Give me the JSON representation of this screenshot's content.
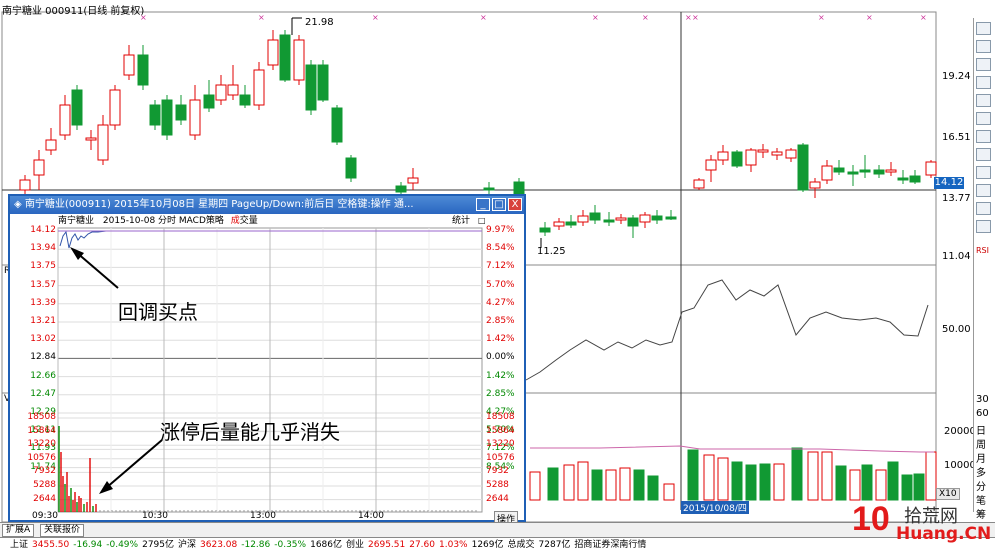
{
  "window": {
    "title": "南宁糖业 000911(日线 前复权)"
  },
  "main_chart": {
    "peak_label": "21.98",
    "trough_label": "11.25",
    "price_ticks": [
      "19.24",
      "16.51",
      "13.77",
      "11.04"
    ],
    "current_price": "14.12",
    "indicator_tick": "50.00",
    "volume_ticks": [
      "20000",
      "10000"
    ],
    "volume_unit": "X10",
    "date_label": "2015/10/08/四",
    "side_letter_r": "R",
    "side_letter_v": "V"
  },
  "popup": {
    "title": "南宁糖业(000911) 2015年10月08日 星期四 PageUp/Down:前后日 空格键:操作 通...",
    "subtitle_name": "南宁糖业",
    "subtitle_info": "2015-10-08 分时 MACD策略",
    "subtitle_chengjiao": "成",
    "subtitle_vol": "交量",
    "stats_label": "统计",
    "price_ticks": [
      "14.12",
      "13.94",
      "13.75",
      "13.57",
      "13.39",
      "13.21",
      "13.02",
      "12.84",
      "12.66",
      "12.47",
      "12.29",
      "12.11",
      "11.93",
      "11.74"
    ],
    "pct_ticks": [
      "9.97%",
      "8.54%",
      "7.12%",
      "5.70%",
      "4.27%",
      "2.85%",
      "1.42%",
      "0.00%",
      "1.42%",
      "2.85%",
      "4.27%",
      "5.70%",
      "7.12%",
      "8.54%"
    ],
    "vol_ticks": [
      "18508",
      "15864",
      "13220",
      "10576",
      "7932",
      "5288",
      "2644"
    ],
    "time_labels": [
      "09:30",
      "10:30",
      "13:00",
      "14:00"
    ],
    "operate_label": "操作",
    "annotation_buy": "回调买点",
    "annotation_volume": "涨停后量能几乎消失",
    "btn_min": "_",
    "btn_max": "□",
    "btn_close": "X"
  },
  "right_toolbar": {
    "labels": [
      "RSI",
      "30",
      "60",
      "日",
      "周",
      "月",
      "多",
      "分",
      "笔",
      "筹"
    ]
  },
  "bottom_tabs": {
    "tab1": "扩展A",
    "tab2": "关联报价"
  },
  "status_bar": {
    "sh_label": "上证",
    "sh_value": "3455.50",
    "sh_change": "-16.94",
    "sh_pct": "-0.49%",
    "sh_amount": "2795亿",
    "sz_label": "沪深",
    "sz_value": "3623.08",
    "sz_change": "-12.86",
    "sz_pct": "-0.35%",
    "sz_amount": "1686亿",
    "cy_label": "创业",
    "cy_value": "2695.51",
    "cy_change": "27.60",
    "cy_pct": "1.03%",
    "cy_amount": "1269亿",
    "total_label": "总成交",
    "total_amount": "7287亿",
    "broker": "招商证券深南行情"
  },
  "logo": {
    "text_cn": "拾荒网",
    "text_en": "Huang.CN",
    "num": "10"
  },
  "colors": {
    "up": "#e00000",
    "down": "#119933",
    "popup_border": "#1f5fb5"
  }
}
